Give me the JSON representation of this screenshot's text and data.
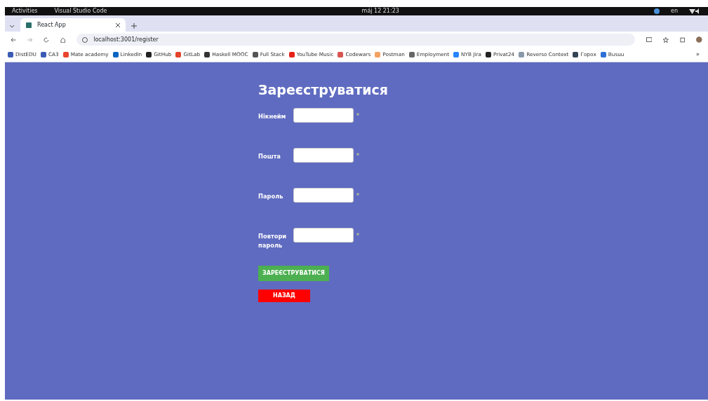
{
  "top_bar": {
    "activities": "Activities",
    "app": "Visual Studio Code",
    "clock": "máj 12 21:23",
    "language": "en"
  },
  "tabs": [
    {
      "label": "React App",
      "selected": true
    }
  ],
  "address_bar": {
    "url": "localhost:3001/register"
  },
  "bookmarks": [
    {
      "label": "DistEDU",
      "color": "#3b5bb5"
    },
    {
      "label": "CA3",
      "color": "#3b5bb5"
    },
    {
      "label": "Mate academy",
      "color": "#e8452c"
    },
    {
      "label": "LinkedIn",
      "color": "#0a66c2"
    },
    {
      "label": "GitHub",
      "color": "#222222"
    },
    {
      "label": "GitLab",
      "color": "#e24329"
    },
    {
      "label": "Haskell MOOC",
      "color": "#333333"
    },
    {
      "label": "Full Stack",
      "color": "#555555"
    },
    {
      "label": "YouTube Music",
      "color": "#e62117"
    },
    {
      "label": "Codewars",
      "color": "#d9534f"
    },
    {
      "label": "Postman",
      "color": "#f4a261"
    },
    {
      "label": "Employment",
      "color": "#666666"
    },
    {
      "label": "NYB Jira",
      "color": "#2684ff"
    },
    {
      "label": "Privat24",
      "color": "#222222"
    },
    {
      "label": "Reverso Context",
      "color": "#8899aa"
    },
    {
      "label": "Горох",
      "color": "#334455"
    },
    {
      "label": "Busuu",
      "color": "#2f6fd6"
    }
  ],
  "bookmarks_more": "»",
  "form": {
    "title": "Зареєструватися",
    "fields": [
      {
        "label": "Нікнейм",
        "required": true
      },
      {
        "label": "Пошта",
        "required": true
      },
      {
        "label": "Пароль",
        "required": true
      },
      {
        "label": "Повтори пароль",
        "required": true
      }
    ],
    "required_mark": "*",
    "buttons": [
      {
        "label": "ЗАРЕЄСТРУВАТИСЯ",
        "kind": "submit"
      },
      {
        "label": "НАЗАД",
        "kind": "back"
      }
    ]
  }
}
